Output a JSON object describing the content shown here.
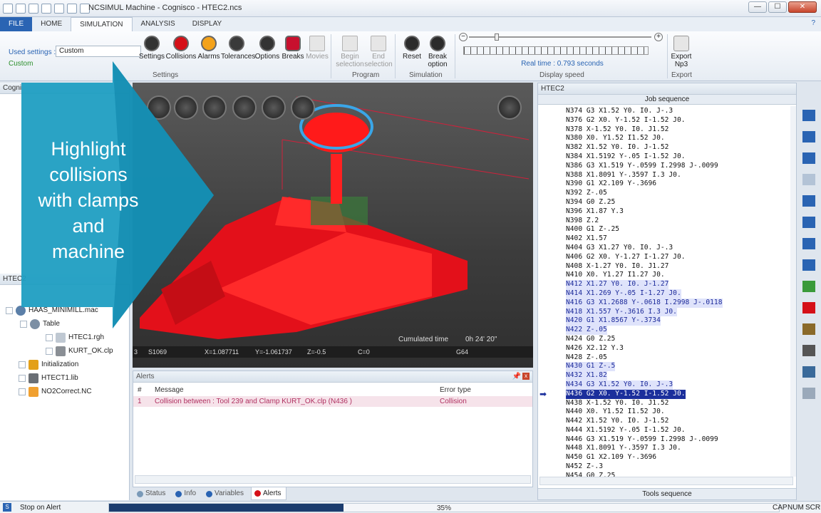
{
  "window": {
    "title": "NCSIMUL Machine - Cognisco - HTEC2.ncs",
    "minimize": "—",
    "maximize": "☐",
    "close": "✕"
  },
  "ribbon_tabs": [
    "FILE",
    "HOME",
    "SIMULATION",
    "ANALYSIS",
    "DISPLAY"
  ],
  "help": "?",
  "settings": {
    "used_label": "Used settings :",
    "used_value": "Custom",
    "custom_label": "Custom",
    "group_label": "Settings"
  },
  "buttons": {
    "settings": "Settings",
    "collisions": "Collisions",
    "alarms": "Alarms",
    "tolerances": "Tolerances",
    "options": "Options",
    "breaks": "Breaks",
    "movies": "Movies",
    "begin_selection_1": "Begin",
    "begin_selection_2": "selection",
    "end_selection_1": "End",
    "end_selection_2": "selection",
    "reset": "Reset",
    "break_option_1": "Break",
    "break_option_2": "option",
    "export_1": "Export",
    "export_2": "Np3"
  },
  "groups": {
    "program": "Program",
    "simulation": "Simulation",
    "speed": "Display speed",
    "export": "Export"
  },
  "speed": {
    "realtime": "Real time : 0.793 seconds",
    "level": 0.14
  },
  "left_panel": {
    "header": "Cogni",
    "header2": "HTEC2",
    "tree": [
      {
        "label": "HAAS_MINIMILL.mac",
        "icon_name": "machine-icon"
      },
      {
        "label": "Table",
        "icon_name": "table-icon"
      },
      {
        "label": "HTEC1.rgh",
        "icon_name": "stock-icon"
      },
      {
        "label": "KURT_OK.clp",
        "icon_name": "clamp-icon"
      },
      {
        "label": "Initialization",
        "icon_name": "init-icon"
      },
      {
        "label": "HTECT1.lib",
        "icon_name": "tool-library-icon"
      },
      {
        "label": "NO2Correct.NC",
        "icon_name": "nc-program-icon"
      }
    ]
  },
  "overlay": {
    "line1": "Highlight",
    "line2": "collisions",
    "line3": "with clamps",
    "line4": "and",
    "line5": "machine",
    "color": "#1f9ec2"
  },
  "viewport": {
    "status": {
      "s": "3",
      "spindle": "S1069",
      "x": "X=1.087711",
      "y": "Y=-1.061737",
      "z": "Z=-0.5",
      "c": "C=0",
      "g": "G64"
    },
    "cumulated_label": "Cumulated time",
    "cumulated_value": "0h 24' 20\""
  },
  "alerts": {
    "title": "Alerts",
    "cols": {
      "num": "#",
      "message": "Message",
      "error_type": "Error type"
    },
    "rows": [
      {
        "num": "1",
        "message": "Collision between : Tool 239 and Clamp KURT_OK.clp  (N436 )",
        "error_type": "Collision"
      }
    ]
  },
  "bottom_tabs": [
    "Status",
    "Info",
    "Variables",
    "Alerts"
  ],
  "nc_panel": {
    "header": "HTEC2",
    "job_sequence": "Job sequence",
    "tools_sequence": "Tools sequence",
    "lines": [
      {
        "t": "N374 G3 X1.52 Y0. I0. J-.3",
        "s": ""
      },
      {
        "t": "N376 G2 X0. Y-1.52 I-1.52 J0.",
        "s": ""
      },
      {
        "t": "N378 X-1.52 Y0. I0. J1.52",
        "s": ""
      },
      {
        "t": "N380 X0. Y1.52 I1.52 J0.",
        "s": ""
      },
      {
        "t": "N382 X1.52 Y0. I0. J-1.52",
        "s": ""
      },
      {
        "t": "N384 X1.5192 Y-.05 I-1.52 J0.",
        "s": ""
      },
      {
        "t": "N386 G3 X1.519 Y-.0599 I.2998 J-.0099",
        "s": ""
      },
      {
        "t": "N388 X1.8091 Y-.3597 I.3 J0.",
        "s": ""
      },
      {
        "t": "N390 G1 X2.109 Y-.3696",
        "s": ""
      },
      {
        "t": "N392 Z-.05",
        "s": ""
      },
      {
        "t": "N394 G0 Z.25",
        "s": ""
      },
      {
        "t": "N396 X1.87 Y.3",
        "s": ""
      },
      {
        "t": "N398 Z.2",
        "s": ""
      },
      {
        "t": "N400 G1 Z-.25",
        "s": ""
      },
      {
        "t": "N402 X1.57",
        "s": ""
      },
      {
        "t": "N404 G3 X1.27 Y0. I0. J-.3",
        "s": ""
      },
      {
        "t": "N406 G2 X0. Y-1.27 I-1.27 J0.",
        "s": ""
      },
      {
        "t": "N408 X-1.27 Y0. I0. J1.27",
        "s": ""
      },
      {
        "t": "N410 X0. Y1.27 I1.27 J0.",
        "s": ""
      },
      {
        "t": "N412 X1.27 Y0. I0. J-1.27",
        "s": "hl"
      },
      {
        "t": "N414 X1.269 Y-.05 I-1.27 J0.",
        "s": "hl"
      },
      {
        "t": "N416 G3 X1.2688 Y-.0618 I.2998 J-.0118",
        "s": "hl"
      },
      {
        "t": "N418 X1.557 Y-.3616 I.3 J0.",
        "s": "hl"
      },
      {
        "t": "N420 G1 X1.8567 Y-.3734",
        "s": "hl"
      },
      {
        "t": "N422 Z-.05",
        "s": "hl"
      },
      {
        "t": "N424 G0 Z.25",
        "s": ""
      },
      {
        "t": "N426 X2.12 Y.3",
        "s": ""
      },
      {
        "t": "N428 Z-.05",
        "s": ""
      },
      {
        "t": "N430 G1 Z-.5",
        "s": "hl"
      },
      {
        "t": "N432 X1.82",
        "s": "hl"
      },
      {
        "t": "N434 G3 X1.52 Y0. I0. J-.3",
        "s": "hl"
      },
      {
        "t": "N436 G2 X0. Y-1.52 I-1.52 J0.",
        "s": "cur"
      },
      {
        "t": "N438 X-1.52 Y0. I0. J1.52",
        "s": ""
      },
      {
        "t": "N440 X0. Y1.52 I1.52 J0.",
        "s": ""
      },
      {
        "t": "N442 X1.52 Y0. I0. J-1.52",
        "s": ""
      },
      {
        "t": "N444 X1.5192 Y-.05 I-1.52 J0.",
        "s": ""
      },
      {
        "t": "N446 G3 X1.519 Y-.0599 I.2998 J-.0099",
        "s": ""
      },
      {
        "t": "N448 X1.8091 Y-.3597 I.3 J0.",
        "s": ""
      },
      {
        "t": "N450 G1 X2.109 Y-.3696",
        "s": ""
      },
      {
        "t": "N452 Z-.3",
        "s": ""
      },
      {
        "t": "N454 G0 Z.25",
        "s": ""
      }
    ]
  },
  "statusbar": {
    "left": "Stop on Alert",
    "progress": 0.35,
    "progress_text": "35%",
    "cap": "CAP",
    "num": "NUM",
    "scrl": "SCRL"
  },
  "colors": {
    "accent": "#2a64b3",
    "collision_red": "#e3101a",
    "alert_text": "#b03060"
  }
}
